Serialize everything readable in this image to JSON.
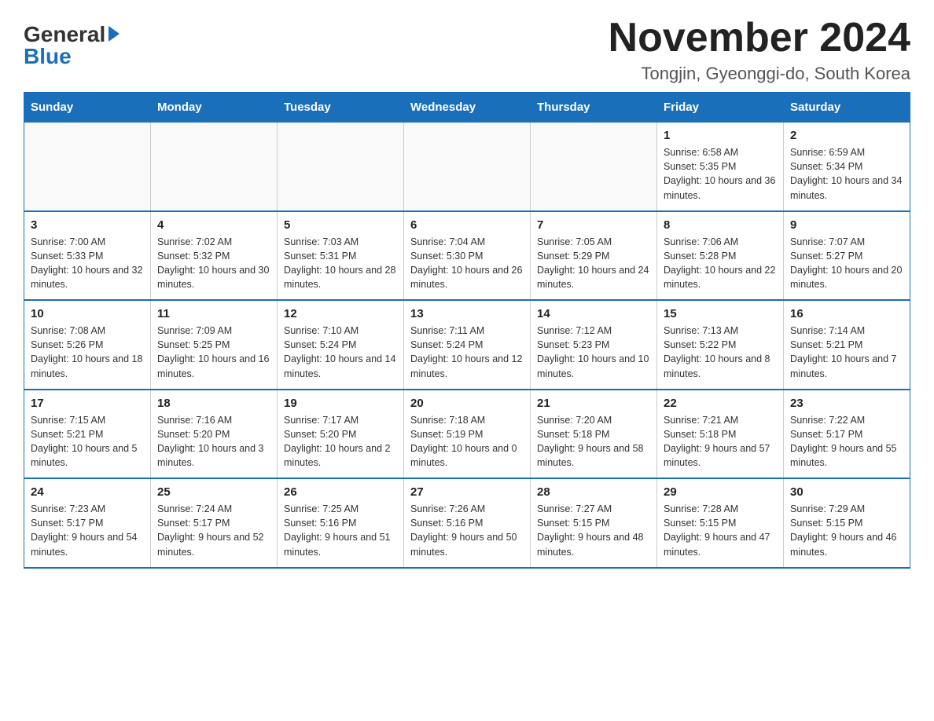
{
  "header": {
    "logo_general": "General",
    "logo_blue": "Blue",
    "title": "November 2024",
    "subtitle": "Tongjin, Gyeonggi-do, South Korea"
  },
  "days_of_week": [
    "Sunday",
    "Monday",
    "Tuesday",
    "Wednesday",
    "Thursday",
    "Friday",
    "Saturday"
  ],
  "weeks": [
    [
      {
        "day": "",
        "info": ""
      },
      {
        "day": "",
        "info": ""
      },
      {
        "day": "",
        "info": ""
      },
      {
        "day": "",
        "info": ""
      },
      {
        "day": "",
        "info": ""
      },
      {
        "day": "1",
        "info": "Sunrise: 6:58 AM\nSunset: 5:35 PM\nDaylight: 10 hours and 36 minutes."
      },
      {
        "day": "2",
        "info": "Sunrise: 6:59 AM\nSunset: 5:34 PM\nDaylight: 10 hours and 34 minutes."
      }
    ],
    [
      {
        "day": "3",
        "info": "Sunrise: 7:00 AM\nSunset: 5:33 PM\nDaylight: 10 hours and 32 minutes."
      },
      {
        "day": "4",
        "info": "Sunrise: 7:02 AM\nSunset: 5:32 PM\nDaylight: 10 hours and 30 minutes."
      },
      {
        "day": "5",
        "info": "Sunrise: 7:03 AM\nSunset: 5:31 PM\nDaylight: 10 hours and 28 minutes."
      },
      {
        "day": "6",
        "info": "Sunrise: 7:04 AM\nSunset: 5:30 PM\nDaylight: 10 hours and 26 minutes."
      },
      {
        "day": "7",
        "info": "Sunrise: 7:05 AM\nSunset: 5:29 PM\nDaylight: 10 hours and 24 minutes."
      },
      {
        "day": "8",
        "info": "Sunrise: 7:06 AM\nSunset: 5:28 PM\nDaylight: 10 hours and 22 minutes."
      },
      {
        "day": "9",
        "info": "Sunrise: 7:07 AM\nSunset: 5:27 PM\nDaylight: 10 hours and 20 minutes."
      }
    ],
    [
      {
        "day": "10",
        "info": "Sunrise: 7:08 AM\nSunset: 5:26 PM\nDaylight: 10 hours and 18 minutes."
      },
      {
        "day": "11",
        "info": "Sunrise: 7:09 AM\nSunset: 5:25 PM\nDaylight: 10 hours and 16 minutes."
      },
      {
        "day": "12",
        "info": "Sunrise: 7:10 AM\nSunset: 5:24 PM\nDaylight: 10 hours and 14 minutes."
      },
      {
        "day": "13",
        "info": "Sunrise: 7:11 AM\nSunset: 5:24 PM\nDaylight: 10 hours and 12 minutes."
      },
      {
        "day": "14",
        "info": "Sunrise: 7:12 AM\nSunset: 5:23 PM\nDaylight: 10 hours and 10 minutes."
      },
      {
        "day": "15",
        "info": "Sunrise: 7:13 AM\nSunset: 5:22 PM\nDaylight: 10 hours and 8 minutes."
      },
      {
        "day": "16",
        "info": "Sunrise: 7:14 AM\nSunset: 5:21 PM\nDaylight: 10 hours and 7 minutes."
      }
    ],
    [
      {
        "day": "17",
        "info": "Sunrise: 7:15 AM\nSunset: 5:21 PM\nDaylight: 10 hours and 5 minutes."
      },
      {
        "day": "18",
        "info": "Sunrise: 7:16 AM\nSunset: 5:20 PM\nDaylight: 10 hours and 3 minutes."
      },
      {
        "day": "19",
        "info": "Sunrise: 7:17 AM\nSunset: 5:20 PM\nDaylight: 10 hours and 2 minutes."
      },
      {
        "day": "20",
        "info": "Sunrise: 7:18 AM\nSunset: 5:19 PM\nDaylight: 10 hours and 0 minutes."
      },
      {
        "day": "21",
        "info": "Sunrise: 7:20 AM\nSunset: 5:18 PM\nDaylight: 9 hours and 58 minutes."
      },
      {
        "day": "22",
        "info": "Sunrise: 7:21 AM\nSunset: 5:18 PM\nDaylight: 9 hours and 57 minutes."
      },
      {
        "day": "23",
        "info": "Sunrise: 7:22 AM\nSunset: 5:17 PM\nDaylight: 9 hours and 55 minutes."
      }
    ],
    [
      {
        "day": "24",
        "info": "Sunrise: 7:23 AM\nSunset: 5:17 PM\nDaylight: 9 hours and 54 minutes."
      },
      {
        "day": "25",
        "info": "Sunrise: 7:24 AM\nSunset: 5:17 PM\nDaylight: 9 hours and 52 minutes."
      },
      {
        "day": "26",
        "info": "Sunrise: 7:25 AM\nSunset: 5:16 PM\nDaylight: 9 hours and 51 minutes."
      },
      {
        "day": "27",
        "info": "Sunrise: 7:26 AM\nSunset: 5:16 PM\nDaylight: 9 hours and 50 minutes."
      },
      {
        "day": "28",
        "info": "Sunrise: 7:27 AM\nSunset: 5:15 PM\nDaylight: 9 hours and 48 minutes."
      },
      {
        "day": "29",
        "info": "Sunrise: 7:28 AM\nSunset: 5:15 PM\nDaylight: 9 hours and 47 minutes."
      },
      {
        "day": "30",
        "info": "Sunrise: 7:29 AM\nSunset: 5:15 PM\nDaylight: 9 hours and 46 minutes."
      }
    ]
  ]
}
